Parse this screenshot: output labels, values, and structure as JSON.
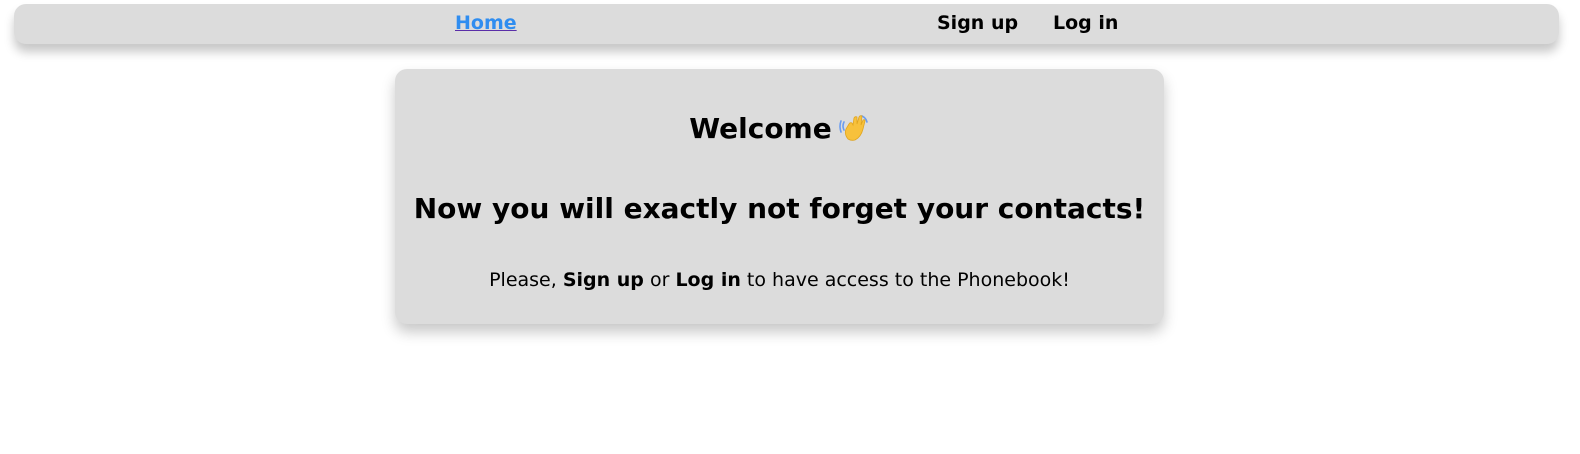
{
  "nav": {
    "home_label": "Home",
    "signup_label": "Sign up",
    "login_label": "Log in"
  },
  "card": {
    "welcome": "Welcome",
    "welcome_icon": "waving-hand-icon",
    "tagline": "Now you will exactly not forget your contacts!",
    "prompt_prefix": "Please,",
    "prompt_signup": "Sign up",
    "prompt_or": "or",
    "prompt_login": "Log in",
    "prompt_suffix": "to have access to the Phonebook!"
  },
  "colors": {
    "background": "#ffffff",
    "surface": "#dcdcdc",
    "link": "#2f8df0",
    "text": "#000000"
  }
}
